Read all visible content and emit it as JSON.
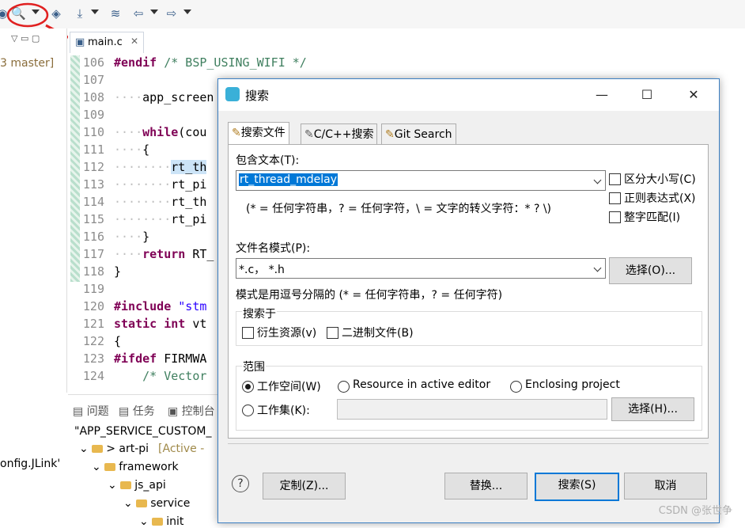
{
  "ide": {
    "editor_tab": "main.c",
    "branch_fragment": "3 master]",
    "left_config_fragment": "onfig.JLink'",
    "code_lines": [
      {
        "n": "106",
        "parts": [
          [
            "kw",
            "#endif"
          ],
          [
            "cm",
            " /* BSP_USING_WIFI */"
          ]
        ]
      },
      {
        "n": "107",
        "parts": []
      },
      {
        "n": "108",
        "parts": [
          [
            "dot",
            "····"
          ],
          [
            "",
            "app_screen"
          ]
        ]
      },
      {
        "n": "109",
        "parts": []
      },
      {
        "n": "110",
        "parts": [
          [
            "dot",
            "····"
          ],
          [
            "kw",
            "while"
          ],
          [
            "",
            "(cou"
          ]
        ]
      },
      {
        "n": "111",
        "parts": [
          [
            "dot",
            "····"
          ],
          [
            "",
            "{"
          ]
        ]
      },
      {
        "n": "112",
        "parts": [
          [
            "dot",
            "········"
          ],
          [
            "hl",
            "rt_th"
          ]
        ]
      },
      {
        "n": "113",
        "parts": [
          [
            "dot",
            "········"
          ],
          [
            "",
            "rt_pi"
          ]
        ]
      },
      {
        "n": "114",
        "parts": [
          [
            "dot",
            "········"
          ],
          [
            "",
            "rt_th"
          ]
        ]
      },
      {
        "n": "115",
        "parts": [
          [
            "dot",
            "········"
          ],
          [
            "",
            "rt_pi"
          ]
        ]
      },
      {
        "n": "116",
        "parts": [
          [
            "dot",
            "····"
          ],
          [
            "",
            "}"
          ]
        ]
      },
      {
        "n": "117",
        "parts": [
          [
            "dot",
            "····"
          ],
          [
            "kw",
            "return"
          ],
          [
            "",
            " RT_"
          ]
        ]
      },
      {
        "n": "118",
        "parts": [
          [
            "",
            "}"
          ]
        ]
      },
      {
        "n": "119",
        "parts": []
      },
      {
        "n": "120",
        "parts": [
          [
            "kw",
            "#include"
          ],
          [
            "str",
            " \"stm"
          ]
        ]
      },
      {
        "n": "121",
        "parts": [
          [
            "kw",
            "static int"
          ],
          [
            "",
            " vt"
          ]
        ]
      },
      {
        "n": "122",
        "parts": [
          [
            "",
            "{"
          ]
        ]
      },
      {
        "n": "123",
        "parts": [
          [
            "kw",
            "#ifdef"
          ],
          [
            "",
            " FIRMWA"
          ]
        ]
      },
      {
        "n": "124",
        "parts": [
          [
            "cm",
            "    /* Vector"
          ]
        ]
      }
    ],
    "bottom_tabs": [
      "问题",
      "任务",
      "控制台"
    ],
    "bottom_title": "\"APP_SERVICE_CUSTOM_",
    "tree": [
      {
        "label": "> art-pi",
        "extra": "[Active -"
      },
      {
        "label": "framework",
        "extra": ""
      },
      {
        "label": "js_api",
        "extra": ""
      },
      {
        "label": "service",
        "extra": ""
      },
      {
        "label": "init",
        "extra": ""
      }
    ]
  },
  "dialog": {
    "title": "搜索",
    "tabs": [
      "搜索文件",
      "C/C++搜索",
      "Git Search"
    ],
    "contains_label": "包含文本(T):",
    "contains_value": "rt_thread_mdelay",
    "hint": "(* = 任何字符串，? = 任何字符，\\ = 文字的转义字符：* ? \\)",
    "case_label": "区分大小写(C)",
    "regex_label": "正则表达式(X)",
    "whole_label": "整字匹配(I)",
    "pattern_label": "文件名模式(P):",
    "pattern_value": "*.c， *.h",
    "choose_button": "选择(O)...",
    "pattern_hint": "模式是用逗号分隔的 (* = 任何字符串，? = 任何字符)",
    "search_in_label": "搜索于",
    "derived_label": "衍生资源(v)",
    "binary_label": "二进制文件(B)",
    "scope_label": "范围",
    "workspace_label": "工作空间(W)",
    "active_editor_label": "Resource in active editor",
    "enclosing_label": "Enclosing project",
    "workset_label": "工作集(K):",
    "workset_choose": "选择(H)...",
    "customize_button": "定制(Z)...",
    "replace_button": "替换...",
    "search_button": "搜索(S)",
    "cancel_button": "取消"
  },
  "watermark": "CSDN @张世争",
  "colors": {
    "accent": "#0078d7",
    "annotation": "#e02020"
  }
}
